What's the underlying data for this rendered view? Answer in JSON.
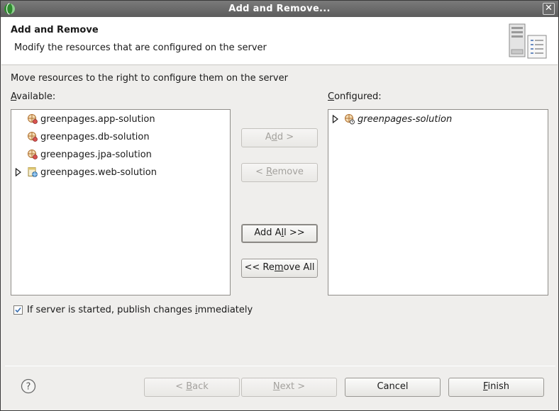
{
  "window": {
    "title": "Add and Remove...",
    "close_glyph": "✕"
  },
  "header": {
    "title": "Add and Remove",
    "description": "Modify the resources that are configured on the server",
    "image_icon": "server-wizard-banner-icon"
  },
  "instruction": "Move resources to the right to configure them on the server",
  "available": {
    "label_mnemonic": "A",
    "label_rest": "vailable:",
    "items": [
      {
        "label": "greenpages.app-solution",
        "icon": "bundle-icon",
        "expandable": false
      },
      {
        "label": "greenpages.db-solution",
        "icon": "bundle-icon",
        "expandable": false
      },
      {
        "label": "greenpages.jpa-solution",
        "icon": "bundle-icon",
        "expandable": false
      },
      {
        "label": "greenpages.web-solution",
        "icon": "web-bundle-icon",
        "expandable": true
      }
    ]
  },
  "configured": {
    "label_mnemonic": "C",
    "label_rest": "onfigured:",
    "items": [
      {
        "label": "greenpages-solution",
        "icon": "plan-icon",
        "expandable": true
      }
    ]
  },
  "buttons": {
    "add": {
      "pre": "A",
      "mn": "d",
      "post": "d >"
    },
    "remove": {
      "pre": "< ",
      "mn": "R",
      "post": "emove"
    },
    "add_all": {
      "pre": "Add A",
      "mn": "l",
      "post": "l >>"
    },
    "remove_all": {
      "pre": "<< Re",
      "mn": "m",
      "post": "ove All"
    }
  },
  "publish_checkbox": {
    "pre": "If server is started, publish changes ",
    "mn": "i",
    "post": "mmediately",
    "checked": true
  },
  "footer": {
    "help_glyph": "?",
    "back": {
      "pre": "< ",
      "mn": "B",
      "post": "ack"
    },
    "next": {
      "pre": "",
      "mn": "N",
      "post": "ext >"
    },
    "cancel": "Cancel",
    "finish": {
      "pre": "",
      "mn": "F",
      "post": "inish"
    }
  }
}
